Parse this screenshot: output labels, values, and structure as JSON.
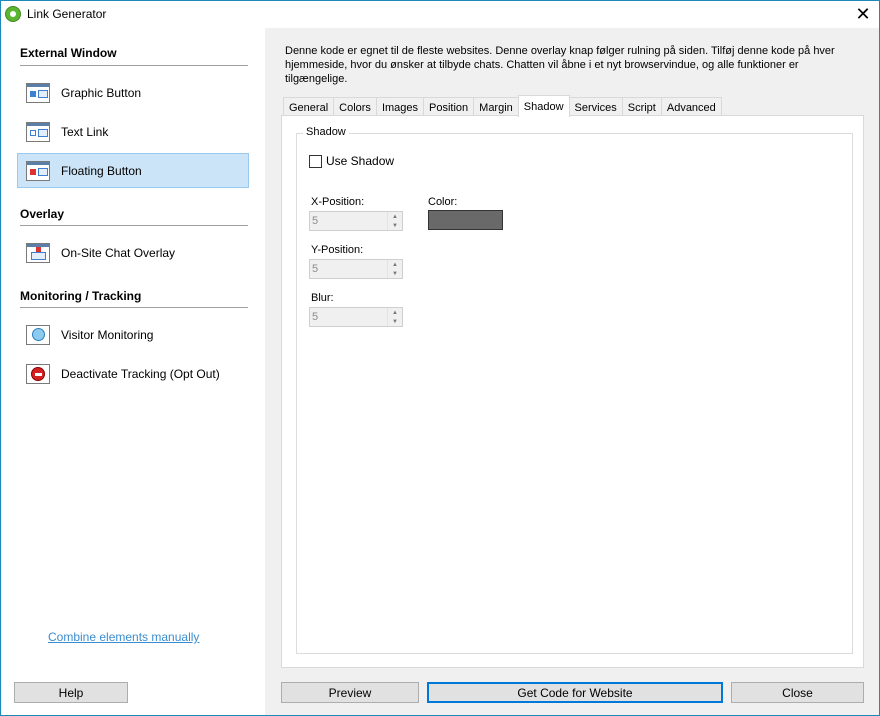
{
  "window": {
    "title": "Link Generator"
  },
  "sidebar": {
    "sections": [
      {
        "header": "External Window"
      },
      {
        "header": "Overlay"
      },
      {
        "header": "Monitoring / Tracking"
      }
    ],
    "items": [
      {
        "label": "Graphic Button",
        "icon": "graphic-button-icon"
      },
      {
        "label": "Text Link",
        "icon": "text-link-icon"
      },
      {
        "label": "Floating Button",
        "icon": "floating-button-icon",
        "selected": true
      },
      {
        "label": "On-Site Chat Overlay",
        "icon": "chat-overlay-icon"
      },
      {
        "label": "Visitor Monitoring",
        "icon": "visitor-monitoring-icon"
      },
      {
        "label": "Deactivate Tracking (Opt Out)",
        "icon": "opt-out-icon"
      }
    ],
    "combine_link": "Combine elements manually"
  },
  "description": "Denne kode er egnet til de fleste websites. Denne overlay knap følger rulning på siden. Tilføj denne kode på hver hjemmeside, hvor du ønsker at tilbyde chats. Chatten vil åbne i et nyt browservindue, og alle funktioner er tilgængelige.",
  "tabs": [
    {
      "label": "General"
    },
    {
      "label": "Colors"
    },
    {
      "label": "Images"
    },
    {
      "label": "Position"
    },
    {
      "label": "Margin"
    },
    {
      "label": "Shadow",
      "active": true
    },
    {
      "label": "Services"
    },
    {
      "label": "Script"
    },
    {
      "label": "Advanced"
    }
  ],
  "shadow": {
    "group_title": "Shadow",
    "use_shadow_label": "Use Shadow",
    "use_shadow_checked": false,
    "x_label": "X-Position:",
    "x_value": "5",
    "y_label": "Y-Position:",
    "y_value": "5",
    "blur_label": "Blur:",
    "blur_value": "5",
    "color_label": "Color:",
    "color_value": "#696969"
  },
  "buttons": {
    "help": "Help",
    "preview": "Preview",
    "get_code": "Get Code for Website",
    "close": "Close"
  }
}
